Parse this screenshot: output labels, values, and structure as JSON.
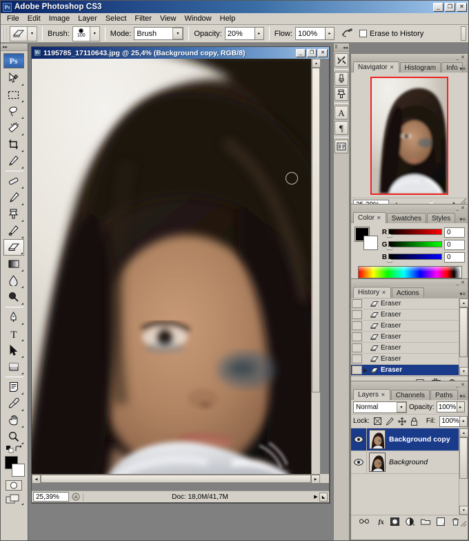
{
  "app": {
    "title": "Adobe Photoshop CS3",
    "logo_text": "Ps",
    "window_buttons": {
      "minimize": "_",
      "maximize": "❐",
      "close": "✕"
    }
  },
  "menubar": {
    "items": [
      {
        "label": "File"
      },
      {
        "label": "Edit"
      },
      {
        "label": "Image"
      },
      {
        "label": "Layer"
      },
      {
        "label": "Select"
      },
      {
        "label": "Filter"
      },
      {
        "label": "View"
      },
      {
        "label": "Window"
      },
      {
        "label": "Help"
      }
    ]
  },
  "options_bar": {
    "tool_icon": "eraser-icon",
    "brush_label": "Brush:",
    "brush_size": "100",
    "mode_label": "Mode:",
    "mode_value": "Brush",
    "opacity_label": "Opacity:",
    "opacity_value": "20%",
    "flow_label": "Flow:",
    "flow_value": "100%",
    "airbrush_icon": "airbrush-icon",
    "erase_to_history_label": "Erase to History",
    "erase_to_history_checked": false
  },
  "toolbox": {
    "logo": "Ps",
    "tools": [
      {
        "name": "move-tool",
        "selected": false
      },
      {
        "name": "marquee-tool",
        "selected": false
      },
      {
        "name": "lasso-tool",
        "selected": false
      },
      {
        "name": "magic-wand-tool",
        "selected": false
      },
      {
        "name": "crop-tool",
        "selected": false
      },
      {
        "name": "slice-tool",
        "selected": false
      },
      {
        "name": "healing-brush-tool",
        "selected": false
      },
      {
        "name": "brush-tool",
        "selected": false
      },
      {
        "name": "clone-stamp-tool",
        "selected": false
      },
      {
        "name": "history-brush-tool",
        "selected": false
      },
      {
        "name": "eraser-tool",
        "selected": true
      },
      {
        "name": "gradient-tool",
        "selected": false
      },
      {
        "name": "blur-tool",
        "selected": false
      },
      {
        "name": "dodge-tool",
        "selected": false
      },
      {
        "name": "pen-tool",
        "selected": false
      },
      {
        "name": "type-tool",
        "selected": false
      },
      {
        "name": "path-selection-tool",
        "selected": false
      },
      {
        "name": "shape-tool",
        "selected": false
      },
      {
        "name": "notes-tool",
        "selected": false
      },
      {
        "name": "eyedropper-tool",
        "selected": false
      },
      {
        "name": "hand-tool",
        "selected": false
      },
      {
        "name": "zoom-tool",
        "selected": false
      }
    ],
    "foreground_color": "#000000",
    "background_color": "#ffffff",
    "quick_mask_icon": "quick-mask-icon",
    "screen_mode_icon": "screen-mode-icon"
  },
  "document": {
    "title": "1195785_17110643.jpg @ 25,4% (Background copy, RGB/8)",
    "status_zoom": "25,39%",
    "status_doc": "Doc: 18,0M/41,7M",
    "window_buttons": {
      "minimize": "_",
      "maximize": "❐",
      "close": "✕"
    }
  },
  "dock_strip": {
    "items": [
      {
        "name": "tool-presets-icon"
      },
      {
        "name": "brushes-icon"
      },
      {
        "name": "clone-source-icon"
      },
      {
        "name": "character-icon"
      },
      {
        "name": "paragraph-icon"
      },
      {
        "name": "layer-comps-icon"
      }
    ]
  },
  "navigator_panel": {
    "tabs": [
      {
        "label": "Navigator",
        "active": true,
        "closable": true
      },
      {
        "label": "Histogram",
        "active": false,
        "closable": false
      },
      {
        "label": "Info",
        "active": false,
        "closable": false
      }
    ],
    "zoom_value": "25.39%",
    "zoom_out_icon": "zoom-out-icon",
    "zoom_in_icon": "zoom-in-icon",
    "view_box_color": "#ee2222"
  },
  "color_panel": {
    "tabs": [
      {
        "label": "Color",
        "active": true,
        "closable": true
      },
      {
        "label": "Swatches",
        "active": false,
        "closable": false
      },
      {
        "label": "Styles",
        "active": false,
        "closable": false
      }
    ],
    "channels": [
      {
        "label": "R",
        "value": "0",
        "color": "#ff0000"
      },
      {
        "label": "G",
        "value": "0",
        "color": "#00ff00"
      },
      {
        "label": "B",
        "value": "0",
        "color": "#0000ff"
      }
    ],
    "foreground_color": "#000000",
    "background_color": "#ffffff"
  },
  "history_panel": {
    "tabs": [
      {
        "label": "History",
        "active": true,
        "closable": true
      },
      {
        "label": "Actions",
        "active": false,
        "closable": false
      }
    ],
    "items": [
      {
        "label": "Eraser",
        "selected": false
      },
      {
        "label": "Eraser",
        "selected": false
      },
      {
        "label": "Eraser",
        "selected": false
      },
      {
        "label": "Eraser",
        "selected": false
      },
      {
        "label": "Eraser",
        "selected": false
      },
      {
        "label": "Eraser",
        "selected": false
      },
      {
        "label": "Eraser",
        "selected": true
      }
    ],
    "footer_icons": [
      {
        "name": "new-document-from-state-icon"
      },
      {
        "name": "new-snapshot-icon"
      },
      {
        "name": "delete-state-icon"
      }
    ]
  },
  "layers_panel": {
    "tabs": [
      {
        "label": "Layers",
        "active": true,
        "closable": true
      },
      {
        "label": "Channels",
        "active": false,
        "closable": false
      },
      {
        "label": "Paths",
        "active": false,
        "closable": false
      }
    ],
    "blend_mode": "Normal",
    "opacity_label": "Opacity:",
    "opacity_value": "100%",
    "lock_label": "Lock:",
    "fill_label": "Fil:",
    "fill_value": "100%",
    "lock_icons": [
      {
        "name": "lock-transparent-pixels-icon"
      },
      {
        "name": "lock-image-pixels-icon"
      },
      {
        "name": "lock-position-icon"
      },
      {
        "name": "lock-all-icon"
      }
    ],
    "layers": [
      {
        "name": "Background copy",
        "selected": true,
        "visible": true,
        "locked": false,
        "italic": false
      },
      {
        "name": "Background",
        "selected": false,
        "visible": true,
        "locked": true,
        "italic": true
      }
    ],
    "footer_icons": [
      {
        "name": "link-layers-icon"
      },
      {
        "name": "layer-style-icon"
      },
      {
        "name": "layer-mask-icon"
      },
      {
        "name": "adjustment-layer-icon"
      },
      {
        "name": "new-group-icon"
      },
      {
        "name": "new-layer-icon"
      },
      {
        "name": "delete-layer-icon"
      }
    ]
  }
}
